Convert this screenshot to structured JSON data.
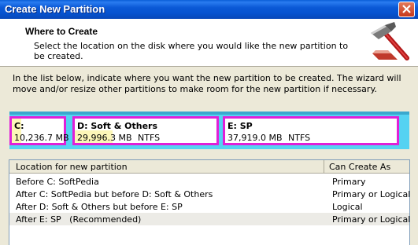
{
  "window": {
    "title": "Create New Partition"
  },
  "header": {
    "title": "Where to Create",
    "description": "Select the location on the disk where you would like the new partition to be created."
  },
  "intro": "In the list below, indicate where you want the new partition to be created. The wizard will move and/or resize other partitions to make room for the new partition if necessary.",
  "partitions": [
    {
      "name": "C:",
      "size": "10,236.7 MB",
      "fs": ""
    },
    {
      "name": "D:  Soft & Others",
      "size": "29,996.3 MB",
      "fs": "NTFS"
    },
    {
      "name": "E:  SP",
      "size": "37,919.0 MB",
      "fs": "NTFS"
    }
  ],
  "list": {
    "columns": [
      "Location for new partition",
      "Can Create As"
    ],
    "rows": [
      {
        "location": "Before C: SoftPedia",
        "type": "Primary"
      },
      {
        "location": "After C: SoftPedia but before D: Soft & Others",
        "type": "Primary or Logical"
      },
      {
        "location": "After D: Soft & Others but before E: SP",
        "type": "Logical"
      },
      {
        "location": "After E: SP   (Recommended)",
        "type": "Primary or Logical"
      }
    ],
    "selected_index": 3
  },
  "icons": {
    "header": "hammer-wizard-icon",
    "close": "close-icon"
  },
  "colors": {
    "partition_border": "#e020d8",
    "disk_bar": "#55d2f2",
    "used_space": "#fcf6b8"
  }
}
